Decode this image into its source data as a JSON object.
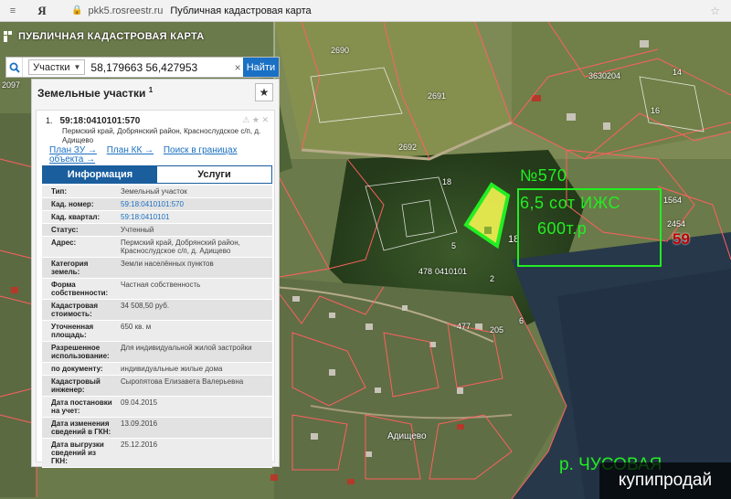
{
  "browser": {
    "nav_icon": "≡",
    "logo": "Я",
    "url": "pkk5.rosreestr.ru",
    "page_title": "Публичная кадастровая карта",
    "bookmark_icon": "☆"
  },
  "app": {
    "title": "ПУБЛИЧНАЯ КАДАСТРОВАЯ КАРТА"
  },
  "search": {
    "type": "Участки",
    "value": "58,179663 56,427953",
    "clear": "×",
    "button": "Найти"
  },
  "panel": {
    "title": "Земельные участки",
    "count": "1",
    "star": "★"
  },
  "parcel": {
    "index": "1.",
    "number": "59:18:0410101:570",
    "address": "Пермский край, Добрянский район, Краснослудское с/п, д. Адищево",
    "links": [
      "План ЗУ →",
      "План КК →",
      "Поиск в границах объекта →"
    ],
    "icons": "⚠ ★ ✕"
  },
  "tabs": {
    "info": "Информация",
    "services": "Услуги"
  },
  "attributes": [
    {
      "key": "Тип:",
      "value": "Земельный участок"
    },
    {
      "key": "Кад. номер:",
      "value": "59:18:0410101:570"
    },
    {
      "key": "Кад. квартал:",
      "value": "59:18:0410101"
    },
    {
      "key": "Статус:",
      "value": "Учтенный"
    },
    {
      "key": "Адрес:",
      "value": "Пермский край, Добрянский район, Краснослудское с/п, д. Адищево"
    },
    {
      "key": "Категория земель:",
      "value": "Земли населённых пунктов"
    },
    {
      "key": "Форма собственности:",
      "value": "Частная собственность"
    },
    {
      "key": "Кадастровая стоимость:",
      "value": "34 508,50 руб."
    },
    {
      "key": "Уточненная площадь:",
      "value": "650 кв. м"
    },
    {
      "key": "Разрешенное использование:",
      "value": "Для индивидуальной жилой застройки"
    },
    {
      "key": "по документу:",
      "value": "индивидуальные жилые дома"
    },
    {
      "key": "Кадастровый инженер:",
      "value": "Сыропятова Елизавета Валерьевна"
    },
    {
      "key": "Дата постановки на учет:",
      "value": "09.04.2015"
    },
    {
      "key": "Дата изменения сведений в ГКН:",
      "value": "13.09.2016"
    },
    {
      "key": "Дата выгрузки сведений из ГКН:",
      "value": "25.12.2016"
    }
  ],
  "map": {
    "labels": {
      "q_3630204": "3630204",
      "n2690": "2690",
      "n2691": "2691",
      "n2692": "2692",
      "n2097": "2097",
      "n18": "18",
      "n18b": "18",
      "n5": "5",
      "n2": "2",
      "n477": "477",
      "n205": "205",
      "n6": "6",
      "n478": "478",
      "q_0410101": "0410101",
      "n14": "14",
      "n16": "16",
      "n1564": "1564",
      "n2454": "2454",
      "n59": "59",
      "village": "Адищево"
    },
    "annotation": {
      "line1": "№570",
      "line2": "6,5 сот ИЖС",
      "line3": "600т.р"
    },
    "river": "р. ЧУСОВАЯ",
    "watermark": "купипродай",
    "colors": {
      "annotation": "#22ee22",
      "boundary": "#ff5a5a",
      "selected": "#ffff55"
    }
  }
}
